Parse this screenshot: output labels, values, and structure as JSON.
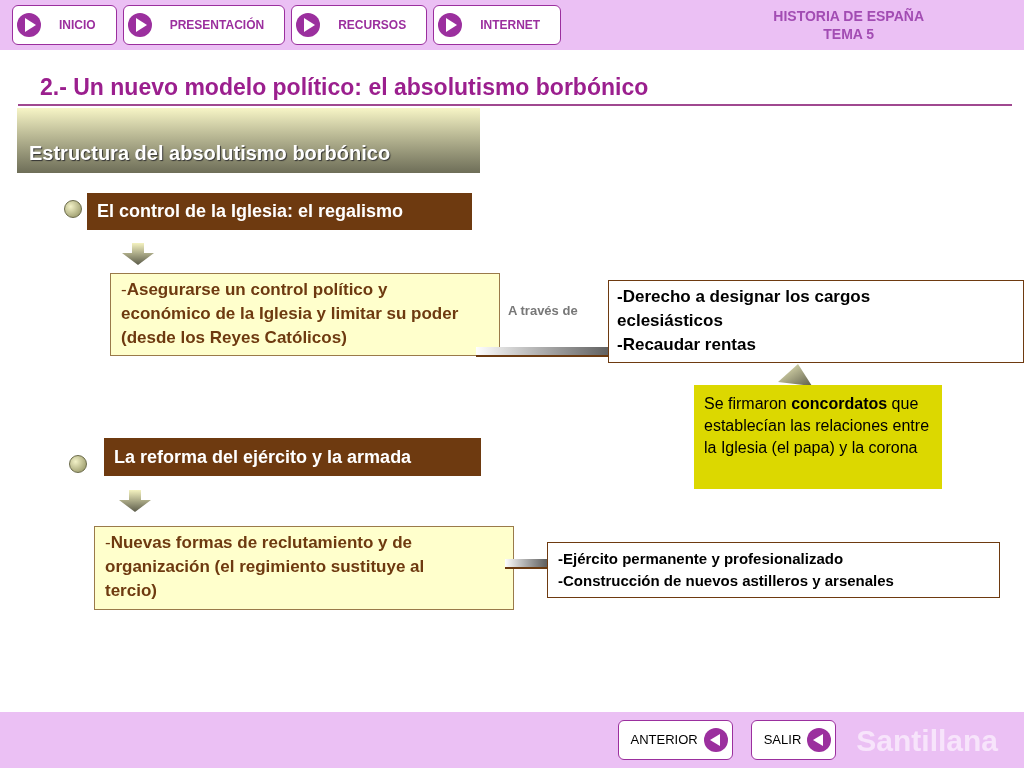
{
  "nav_buttons": [
    {
      "label": "INICIO"
    },
    {
      "label": "PRESENTACIÓN"
    },
    {
      "label": "RECURSOS"
    },
    {
      "label": "INTERNET"
    }
  ],
  "header": {
    "subject": "HISTORIA DE ESPAÑA",
    "topic": "TEMA 5"
  },
  "title": "2.- Un nuevo modelo político: el absolutismo borbónico",
  "section_title": "Estructura del absolutismo borbónico",
  "sections": [
    {
      "heading": "El control de la Iglesia: el regalismo",
      "summary": "-**Asegurarse un control político y económico de la Iglesia y limitar su poder (desde los Reyes Católicos)**",
      "connector_label": "A través de",
      "details": [
        "-Derecho a designar los cargos eclesiásticos",
        "-Recaudar rentas"
      ],
      "note": "Se firmaron **concordatos** que establecían las relaciones entre la Iglesia (el papa) y la corona"
    },
    {
      "heading": "La reforma del ejército y la armada",
      "summary": "-**Nuevas formas de reclutamiento y de organización (el regimiento sustituye al tercio)**",
      "details": [
        "-Ejército permanente y profesionalizado",
        "-Construcción de nuevos astilleros y arsenales"
      ]
    }
  ],
  "footer_buttons": [
    {
      "label": "ANTERIOR"
    },
    {
      "label": "SALIR"
    }
  ],
  "brand": "Santillana"
}
